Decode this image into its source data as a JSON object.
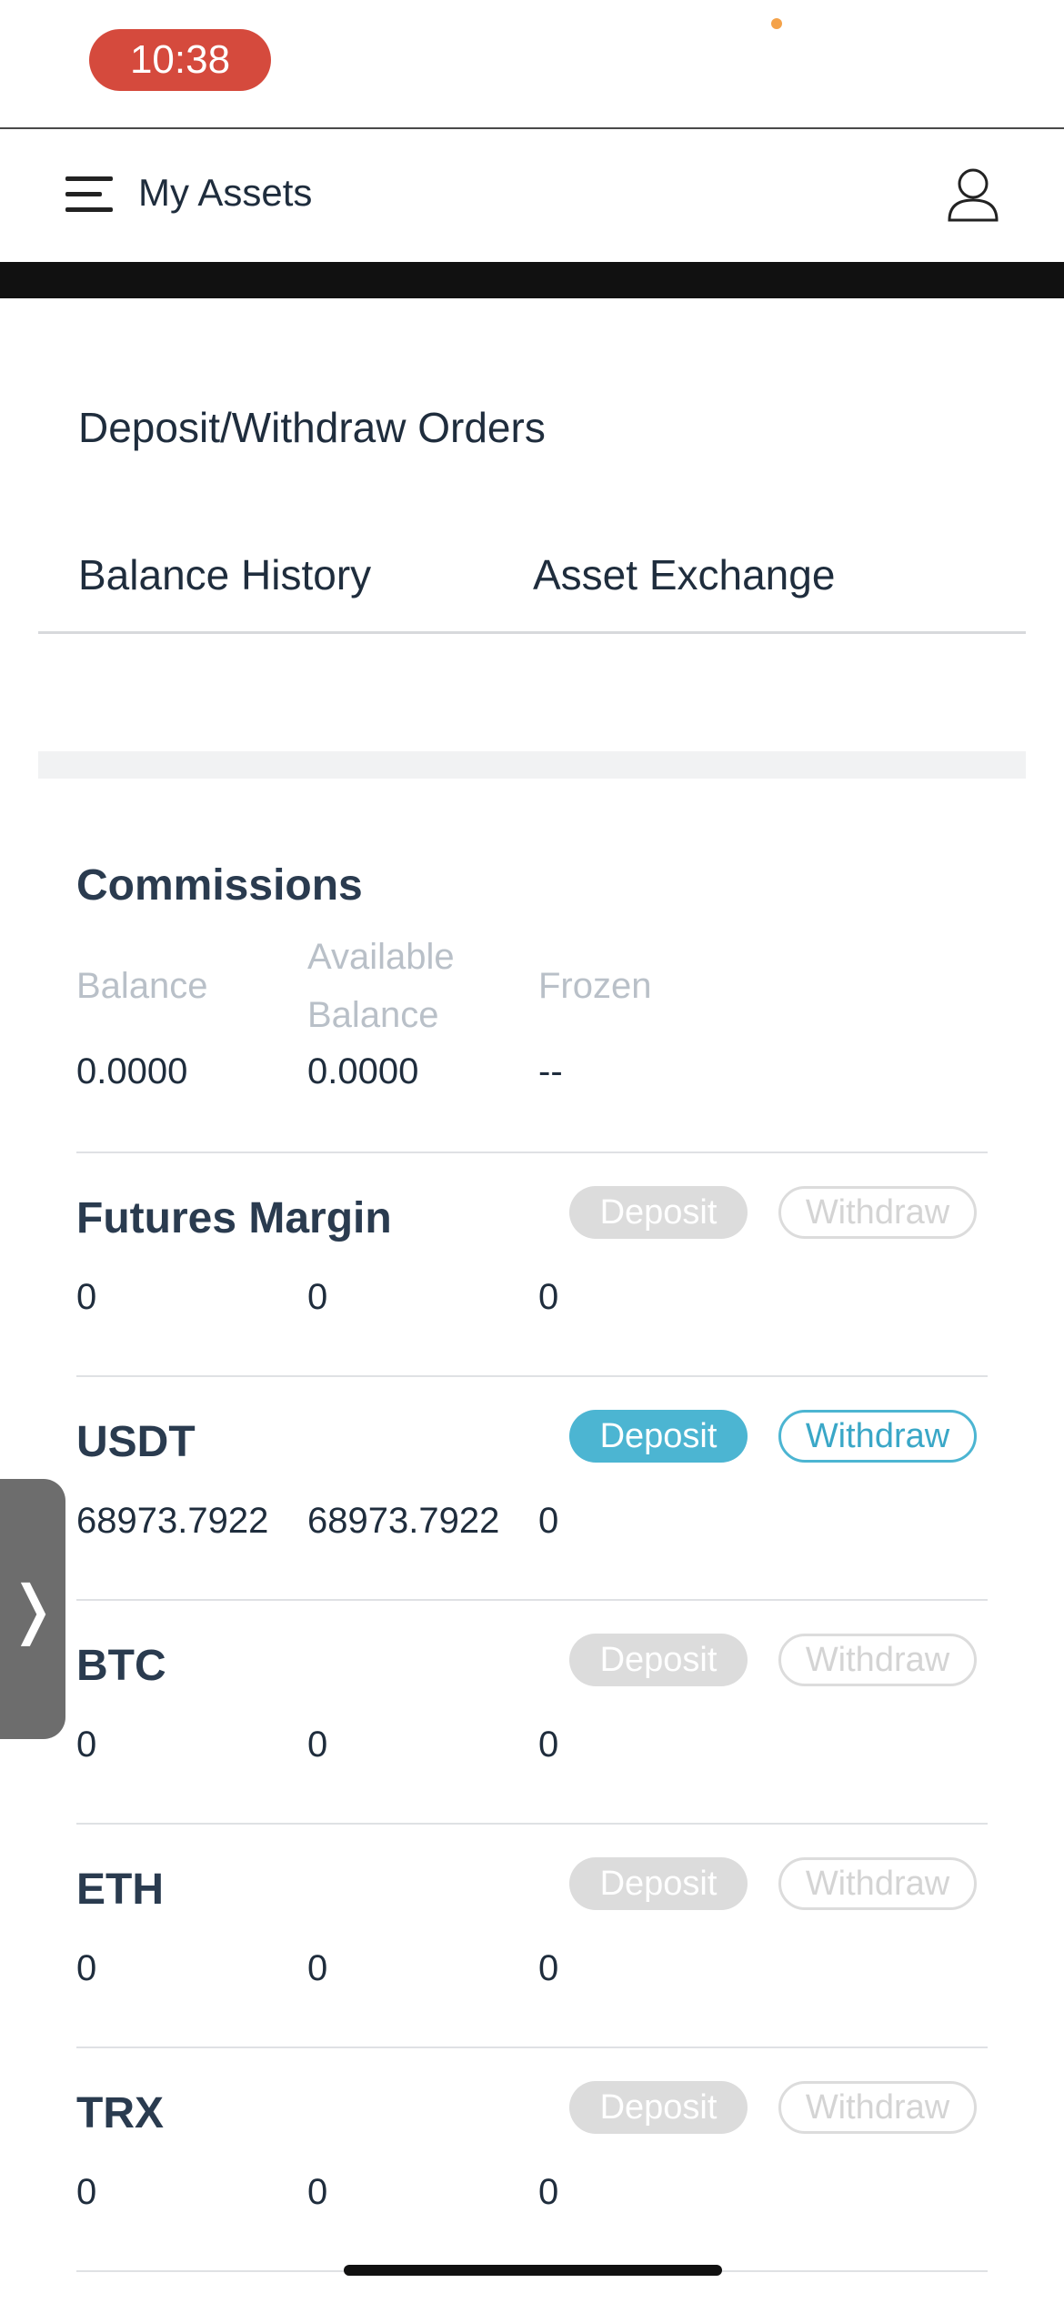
{
  "status_bar": {
    "time": "10:38"
  },
  "header": {
    "title": "My Assets"
  },
  "links": {
    "deposit_withdraw_orders": "Deposit/Withdraw Orders",
    "balance_history": "Balance History",
    "asset_exchange": "Asset Exchange"
  },
  "commissions": {
    "title": "Commissions",
    "labels": {
      "balance": "Balance",
      "available_line1": "Available",
      "available_line2": "Balance",
      "frozen": "Frozen"
    },
    "values": {
      "balance": "0.0000",
      "available": "0.0000",
      "frozen": "--"
    }
  },
  "buttons": {
    "deposit": "Deposit",
    "withdraw": "Withdraw"
  },
  "assets": [
    {
      "name": "Futures Margin",
      "balance": "0",
      "available": "0",
      "frozen": "0",
      "active": false
    },
    {
      "name": "USDT",
      "balance": "68973.7922",
      "available": "68973.7922",
      "frozen": "0",
      "active": true
    },
    {
      "name": "BTC",
      "balance": "0",
      "available": "0",
      "frozen": "0",
      "active": false
    },
    {
      "name": "ETH",
      "balance": "0",
      "available": "0",
      "frozen": "0",
      "active": false
    },
    {
      "name": "TRX",
      "balance": "0",
      "available": "0",
      "frozen": "0",
      "active": false
    }
  ],
  "side_tab": {
    "glyph": "❭"
  },
  "colors": {
    "accent": "#4cb5d2",
    "time_pill": "#d54a3d",
    "disabled": "#dcdcdc"
  }
}
